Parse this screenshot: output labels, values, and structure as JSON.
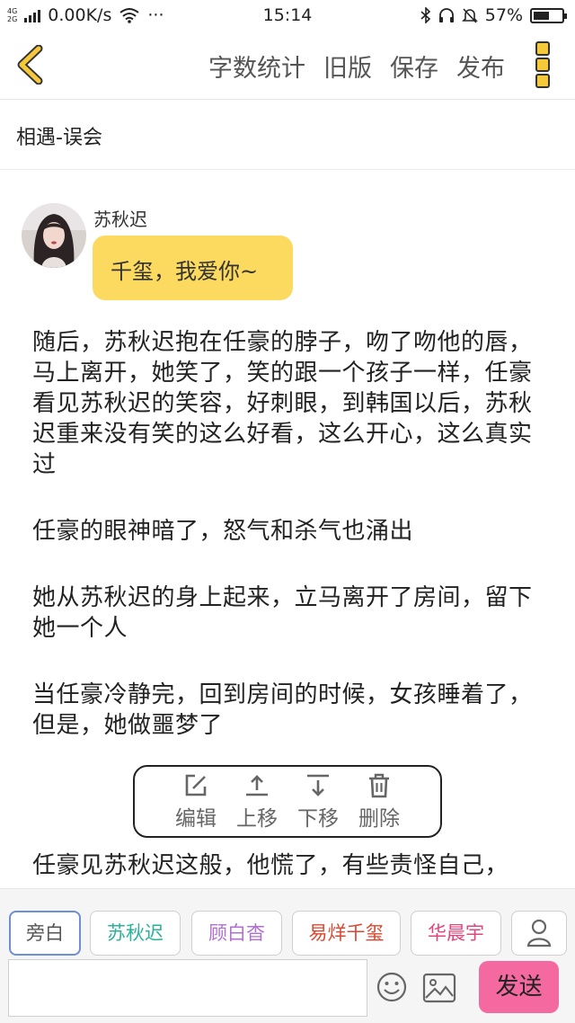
{
  "status_bar": {
    "net_tag_top": "4G",
    "net_tag_bottom": "2G",
    "speed": "0.00K/s",
    "dots": "···",
    "time": "15:14",
    "battery": "57%",
    "battery_level": 0.57
  },
  "header": {
    "back_icon": "chevron-left",
    "actions": [
      "字数统计",
      "旧版",
      "保存",
      "发布"
    ],
    "more_icon": "three-square-dots",
    "accent_color": "#f6c93b"
  },
  "chapter": {
    "title": "相遇-误会"
  },
  "message": {
    "speaker": "苏秋迟",
    "text": "千玺，我爱你~",
    "bubble_color": "#fcd95f"
  },
  "paragraphs": [
    "随后，苏秋迟抱在任豪的脖子，吻了吻他的唇，马上离开，她笑了，笑的跟一个孩子一样，任豪看见苏秋迟的笑容，好刺眼，到韩国以后，苏秋迟重来没有笑的这么好看，这么开心，这么真实过",
    "任豪的眼神暗了，怒气和杀气也涌出",
    "她从苏秋迟的身上起来，立马离开了房间，留下她一个人",
    "当任豪冷静完，回到房间的时候，女孩睡着了，但是，她做噩梦了",
    "任豪见苏秋迟这般，他慌了，有些责怪自己，"
  ],
  "float_toolbar": {
    "items": [
      {
        "label": "编辑",
        "icon": "edit-icon"
      },
      {
        "label": "上移",
        "icon": "move-up-icon"
      },
      {
        "label": "下移",
        "icon": "move-down-icon"
      },
      {
        "label": "删除",
        "icon": "trash-icon"
      }
    ]
  },
  "roles": [
    {
      "label": "旁白",
      "color": "#555555",
      "active": true
    },
    {
      "label": "苏秋迟",
      "color": "#2bb39a",
      "active": false
    },
    {
      "label": "顾白杳",
      "color": "#b070d0",
      "active": false
    },
    {
      "label": "易烊千玺",
      "color": "#d9472f",
      "active": false
    },
    {
      "label": "华晨宇",
      "color": "#e0457b",
      "active": false
    }
  ],
  "input": {
    "placeholder": "",
    "send_label": "发送",
    "send_color": "#f46aa0"
  }
}
